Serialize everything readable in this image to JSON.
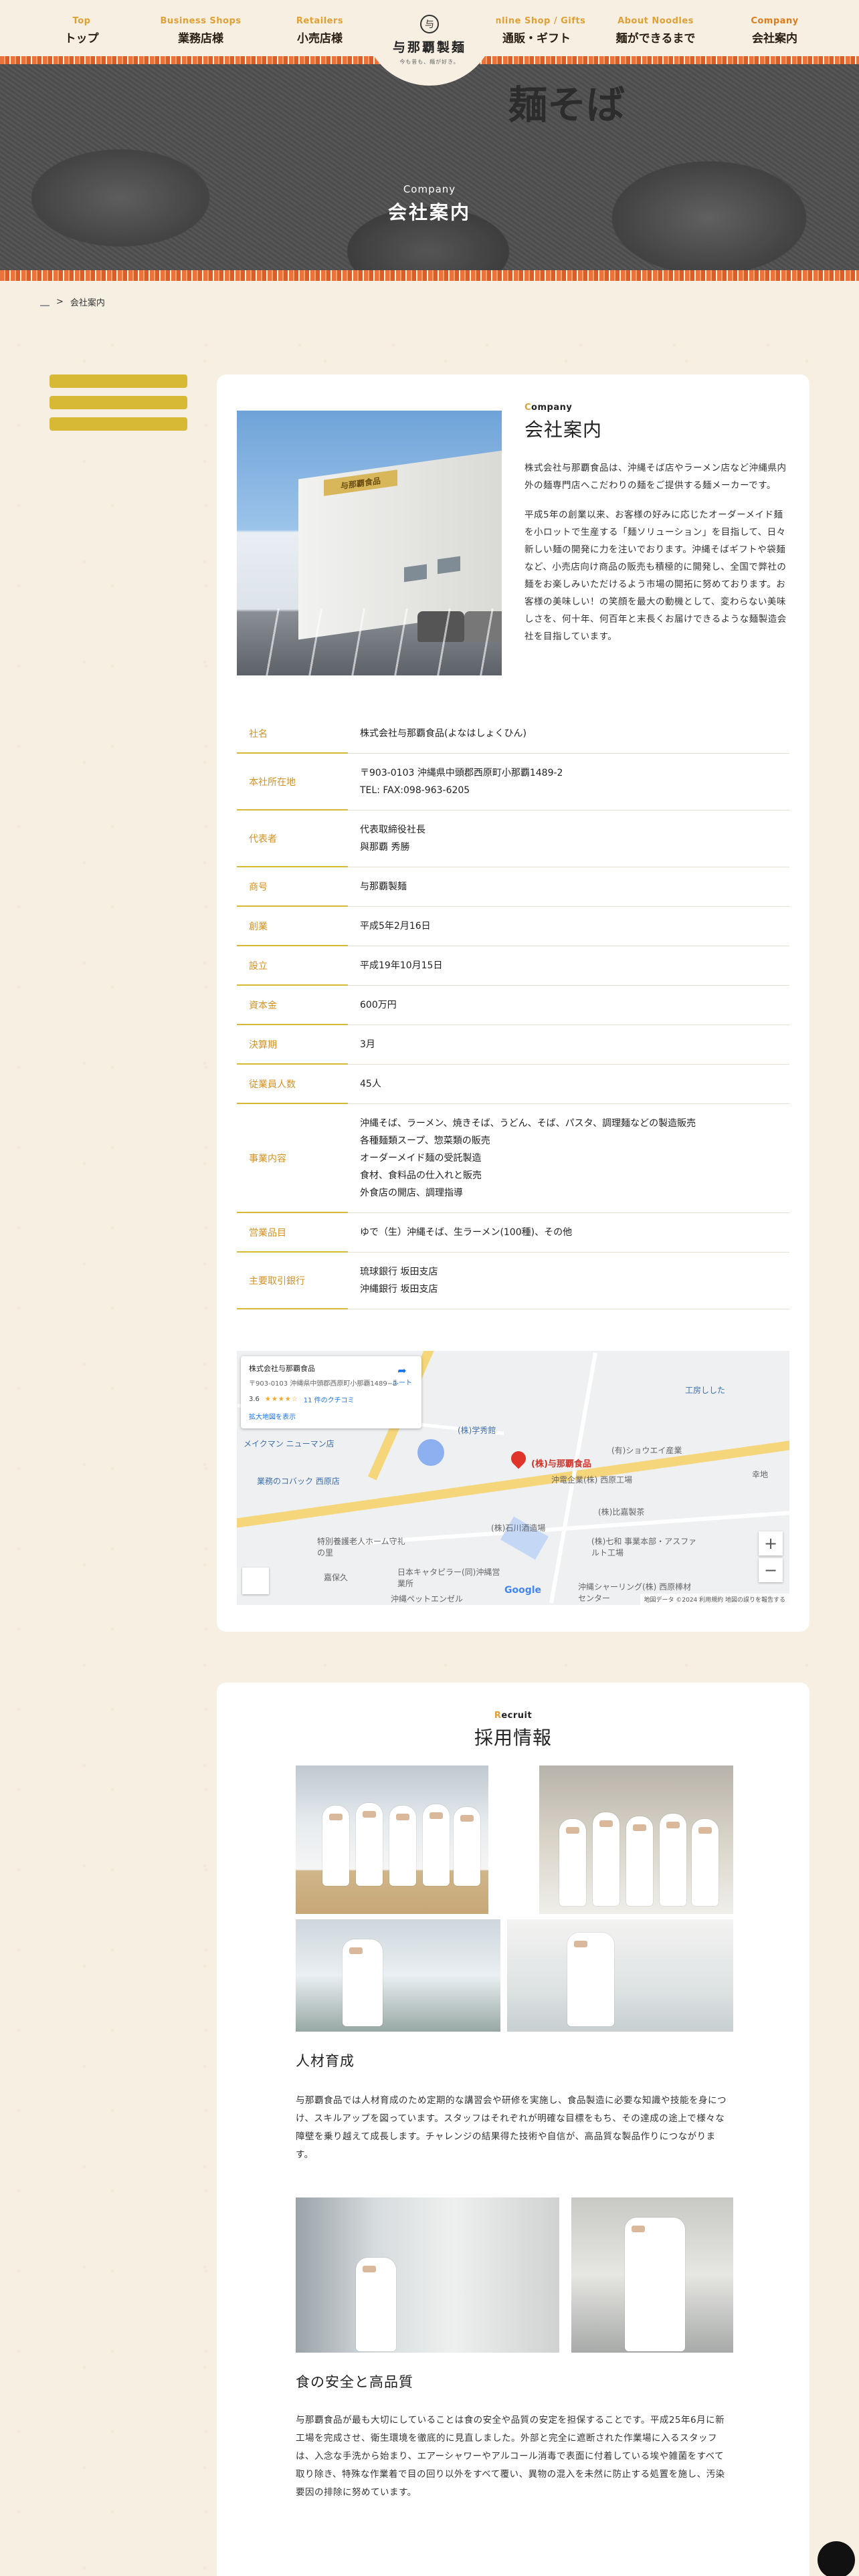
{
  "nav": {
    "left": [
      {
        "en": "Top",
        "jp": "トップ"
      },
      {
        "en": "Business Shops",
        "jp": "業務店様"
      },
      {
        "en": "Retailers",
        "jp": "小売店様"
      }
    ],
    "right": [
      {
        "en": "Online Shop / Gifts",
        "jp": "通販・ギフト"
      },
      {
        "en": "About Noodles",
        "jp": "麺ができるまで"
      },
      {
        "en": "Company",
        "jp": "会社案内"
      }
    ]
  },
  "logo": {
    "mark": "与",
    "name": "与那覇製麺",
    "tagline": "今も昔も、麺が好き。"
  },
  "hero": {
    "sign": "麺そば",
    "en": "Company",
    "jp": "会社案内"
  },
  "breadcrumb": {
    "sep": ">",
    "current": "会社案内"
  },
  "company": {
    "en": "Company",
    "jp": "会社案内",
    "photo_sign": "与那覇食品",
    "intro": [
      "株式会社与那覇食品は、沖縄そば店やラーメン店など沖縄県内外の麺専門店へこだわりの麺をご提供する麺メーカーです。",
      "平成5年の創業以来、お客様の好みに応じたオーダーメイド麺を小ロットで生産する「麺ソリューション」を目指して、日々新しい麺の開発に力を注いでおります。沖縄そばギフトや袋麺など、小売店向け商品の販売も積極的に開発し、全国で弊社の麺をお楽しみいただけるよう市場の開拓に努めております。お客様の美味しい！の笑顔を最大の動機として、変わらない美味しさを、何十年、何百年と末長くお届けできるような麺製造会社を目指しています。"
    ],
    "table": [
      {
        "k": "社名",
        "v": [
          "株式会社与那覇食品(よなはしょくひん)"
        ]
      },
      {
        "k": "本社所在地",
        "v": [
          "〒903-0103 沖縄県中頭郡西原町小那覇1489-2",
          "TEL: FAX:098-963-6205"
        ]
      },
      {
        "k": "代表者",
        "v": [
          "代表取締役社長",
          "與那覇 秀勝"
        ]
      },
      {
        "k": "商号",
        "v": [
          "与那覇製麺"
        ]
      },
      {
        "k": "創業",
        "v": [
          "平成5年2月16日"
        ]
      },
      {
        "k": "設立",
        "v": [
          "平成19年10月15日"
        ]
      },
      {
        "k": "資本金",
        "v": [
          "600万円"
        ]
      },
      {
        "k": "決算期",
        "v": [
          "3月"
        ]
      },
      {
        "k": "従業員人数",
        "v": [
          "45人"
        ]
      },
      {
        "k": "事業内容",
        "v": [
          "沖縄そば、ラーメン、焼きそば、うどん、そば、パスタ、調理麺などの製造販売",
          "各種麺類スープ、惣菜類の販売",
          "オーダーメイド麺の受託製造",
          "食材、食料品の仕入れと販売",
          "外食店の開店、調理指導"
        ]
      },
      {
        "k": "営業品目",
        "v": [
          "ゆで（生）沖縄そば、生ラーメン(100種)、その他"
        ]
      },
      {
        "k": "主要取引銀行",
        "v": [
          "琉球銀行 坂田支店",
          "沖縄銀行 坂田支店"
        ]
      }
    ]
  },
  "map": {
    "card_title": "株式会社与那覇食品",
    "card_addr": "〒903-0103 沖縄県中頭郡西原町小那覇1489−2",
    "rating": "3.6",
    "stars": "★★★★☆",
    "reviews": "11 件のクチコミ",
    "larger": "拡大地図を表示",
    "route": "ルート",
    "pin": "(株)与那覇食品",
    "labels": [
      {
        "t": "(株)学秀館",
        "c": "blue"
      },
      {
        "t": "メイクマン ニューマン店",
        "c": "blue"
      },
      {
        "t": "業務のコバック 西原店",
        "c": "blue"
      },
      {
        "t": "(有)ショウエイ産業",
        "c": "gray"
      },
      {
        "t": "沖電企業(株) 西原工場",
        "c": "gray"
      },
      {
        "t": "(株)石川酒造場",
        "c": "gray"
      },
      {
        "t": "(株)比嘉製茶",
        "c": "gray"
      },
      {
        "t": "工房しした",
        "c": "blue"
      },
      {
        "t": "(株)七和 事業本部・アスファルト工場",
        "c": "gray"
      },
      {
        "t": "特別養護老人ホーム守礼の里",
        "c": "gray"
      },
      {
        "t": "日本キャタピラー(同)沖縄営業所",
        "c": "gray"
      },
      {
        "t": "沖縄ペットエンゼル",
        "c": "gray"
      },
      {
        "t": "沖縄シャーリング(株) 西原棒材センター",
        "c": "gray"
      },
      {
        "t": "嘉保久",
        "c": "gray"
      },
      {
        "t": "幸地",
        "c": "gray"
      }
    ],
    "google": "Google",
    "footer": "地図データ ©2024  利用規約  地図の誤りを報告する"
  },
  "recruit": {
    "en": "Recruit",
    "jp": "採用情報",
    "sections": [
      {
        "title": "人材育成",
        "body": "与那覇食品では人材育成のため定期的な講習会や研修を実施し、食品製造に必要な知識や技能を身につけ、スキルアップを図っています。スタッフはそれぞれが明確な目標をもち、その達成の途上で様々な障壁を乗り越えて成長します。チャレンジの結果得た技術や自信が、高品質な製品作りにつながります。"
      },
      {
        "title": "食の安全と高品質",
        "body": "与那覇食品が最も大切にしていることは食の安全や品質の安定を担保することです。平成25年6月に新工場を完成させ、衛生環境を徹底的に見直しました。外部と完全に遮断された作業場に入るスタッフは、入念な手洗から始まり、エアーシャワーやアルコール消毒で表面に付着している埃や雑菌をすべて取り除き、特殊な作業着で目の回り以外をすべて覆い、異物の混入を未然に防止する処置を施し、汚染要因の排除に努めています。"
      }
    ]
  }
}
